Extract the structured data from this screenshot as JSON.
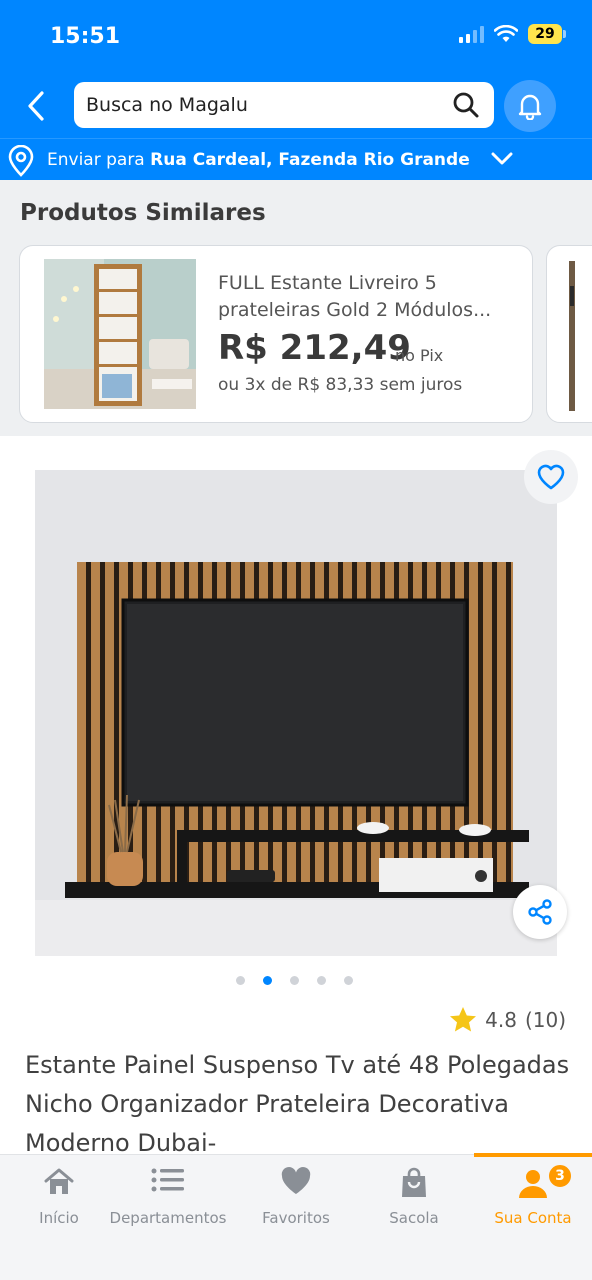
{
  "status_bar": {
    "time": "15:51",
    "battery": "29"
  },
  "search": {
    "placeholder": "Busca no Magalu"
  },
  "address": {
    "prefix": "Enviar para",
    "location": "Rua Cardeal, Fazenda Rio Grande"
  },
  "similar_products": {
    "title": "Produtos Similares",
    "items": [
      {
        "name": "FULL Estante Livreiro 5 prateleiras Gold 2 Módulos...",
        "price": "R$ 212,49",
        "price_note": "no Pix",
        "installments": "ou 3x de R$ 83,33 sem juros"
      }
    ]
  },
  "product": {
    "image_dots": 5,
    "active_dot": 1,
    "rating": "4.8",
    "rating_count": "(10)",
    "title": "Estante Painel Suspenso Tv até 48 Polegadas Nicho Organizador Prateleira Decorativa Moderno Dubai-"
  },
  "bottom_nav": {
    "items": [
      {
        "label": "Início",
        "icon": "home-icon"
      },
      {
        "label": "Departamentos",
        "icon": "list-icon"
      },
      {
        "label": "Favoritos",
        "icon": "heart-icon"
      },
      {
        "label": "Sacola",
        "icon": "bag-icon"
      },
      {
        "label": "Sua Conta",
        "icon": "user-icon",
        "badge": "3"
      }
    ],
    "active_index": 4
  },
  "colors": {
    "brand_blue": "#0086ff",
    "accent_orange": "#ff9a00",
    "star": "#f5c518"
  }
}
